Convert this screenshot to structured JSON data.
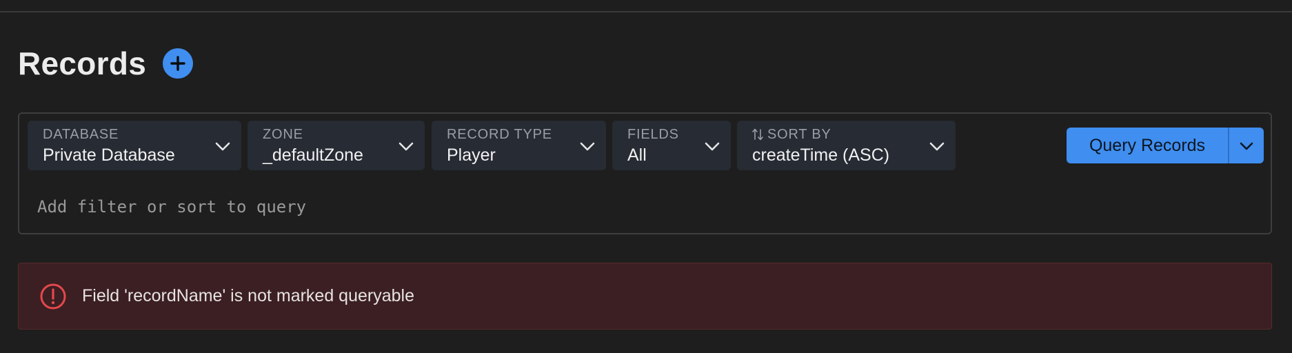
{
  "header": {
    "title": "Records"
  },
  "selectors": [
    {
      "label": "DATABASE",
      "value": "Private Database"
    },
    {
      "label": "ZONE",
      "value": "_defaultZone"
    },
    {
      "label": "RECORD TYPE",
      "value": "Player"
    },
    {
      "label": "FIELDS",
      "value": "All"
    },
    {
      "label": "SORT BY",
      "value": "createTime (ASC)"
    }
  ],
  "query": {
    "button_label": "Query Records",
    "filter_placeholder": "Add filter or sort to query",
    "filter_value": ""
  },
  "error": {
    "message": "Field 'recordName' is not marked queryable"
  },
  "colors": {
    "accent": "#3f8ef0",
    "background": "#1e1e1e",
    "selector_bg": "#272b33",
    "error_bg": "#3c1f22",
    "error_icon": "#e5484d"
  },
  "icons": {
    "add": "plus-circle-icon",
    "selector_dropdown": "chevron-down-icon",
    "sort": "sort-arrows-icon",
    "error": "exclamation-circle-icon"
  }
}
